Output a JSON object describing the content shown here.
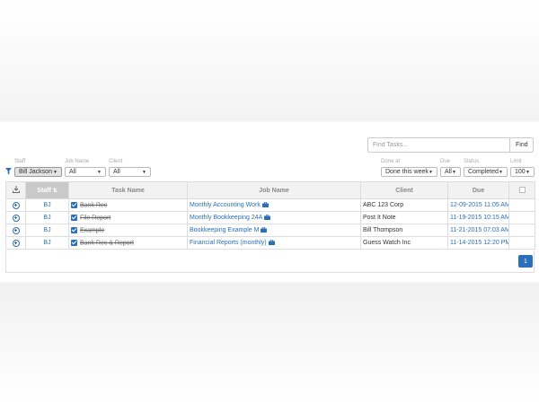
{
  "search": {
    "placeholder": "Find Tasks...",
    "button_label": "Find"
  },
  "filters": {
    "staff": {
      "label": "Staff",
      "value": "Bill Jackson"
    },
    "job_name": {
      "label": "Job Name",
      "value": "All"
    },
    "client": {
      "label": "Client",
      "value": "All"
    },
    "done_at": {
      "label": "Done at",
      "value": "Done this week"
    },
    "due": {
      "label": "Due",
      "value": "All"
    },
    "status": {
      "label": "Status",
      "value": "Completed"
    },
    "limit": {
      "label": "Limit",
      "value": "100"
    }
  },
  "table": {
    "headers": {
      "staff": "Staff",
      "task_name": "Task Name",
      "job_name": "Job Name",
      "client": "Client",
      "due": "Due"
    },
    "rows": [
      {
        "staff": "BJ",
        "task": "Bank Rec",
        "job": "Monthly Accounting Work",
        "client": "ABC 123 Corp",
        "due": "12-09-2015 11:05 AM"
      },
      {
        "staff": "BJ",
        "task": "File Report",
        "job": "Monthly Bookkeeping 24A",
        "client": "Post It Note",
        "due": "11-19-2015 10:15 AM"
      },
      {
        "staff": "BJ",
        "task": "Example",
        "job": "Bookkeeping Example M",
        "client": "Bill Thompson",
        "due": "11-21-2015 07:03 AM"
      },
      {
        "staff": "BJ",
        "task": "Bank Rec & Report",
        "job": "Financial Reports (monthly)",
        "client": "Guess Watch Inc",
        "due": "11-14-2015 12:20 PM"
      }
    ]
  },
  "pagination": {
    "current_page": "1"
  },
  "colors": {
    "accent": "#2a6fb7",
    "header_bg": "#f2f2f2",
    "staff_header_bg": "#c9c9c9"
  },
  "icons": {
    "filter": "filter-icon",
    "download": "download-icon",
    "row_action": "plus-circle-icon",
    "job": "briefcase-icon",
    "sort": "sort-icon"
  }
}
